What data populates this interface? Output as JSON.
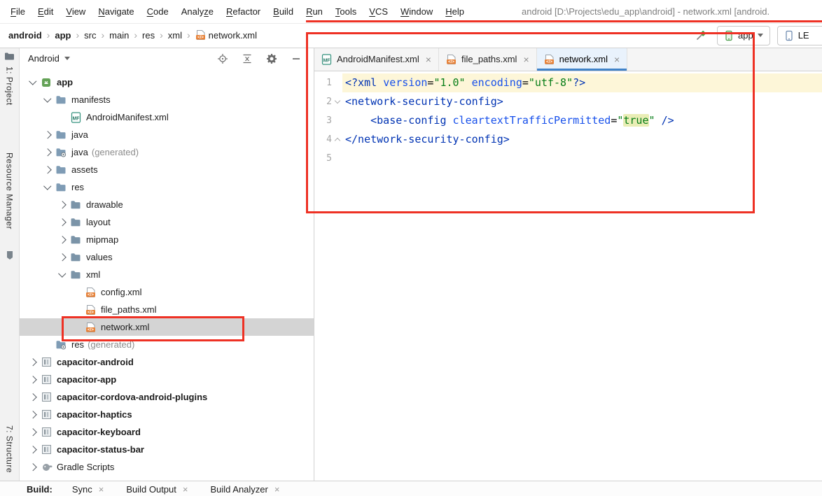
{
  "colors": {
    "annotation_red": "#ee3124",
    "tab_accent": "#4083c9",
    "tree_selection": "#d4d4d4",
    "caret_line": "#fdf6d8",
    "value_highlight": "#e9edb5"
  },
  "menu_bar": {
    "items": [
      {
        "label": "File",
        "mnemonic": 0
      },
      {
        "label": "Edit",
        "mnemonic": 0
      },
      {
        "label": "View",
        "mnemonic": 0
      },
      {
        "label": "Navigate",
        "mnemonic": 0
      },
      {
        "label": "Code",
        "mnemonic": 0
      },
      {
        "label": "Analyze",
        "mnemonic": 5
      },
      {
        "label": "Refactor",
        "mnemonic": 0
      },
      {
        "label": "Build",
        "mnemonic": 0
      },
      {
        "label": "Run",
        "mnemonic": 0
      },
      {
        "label": "Tools",
        "mnemonic": 0
      },
      {
        "label": "VCS",
        "mnemonic": 0
      },
      {
        "label": "Window",
        "mnemonic": 0
      },
      {
        "label": "Help",
        "mnemonic": 0
      }
    ],
    "window_title": "android [D:\\Projects\\edu_app\\android] - network.xml [android."
  },
  "toolbar": {
    "breadcrumbs": [
      {
        "label": "android",
        "bold": true
      },
      {
        "label": "app",
        "bold": true
      },
      {
        "label": "src"
      },
      {
        "label": "main"
      },
      {
        "label": "res"
      },
      {
        "label": "xml"
      },
      {
        "label": "network.xml",
        "icon": "xml-file"
      }
    ],
    "run_config_label": "app",
    "device_button_label": "LE"
  },
  "tool_stripe": {
    "items": [
      {
        "kind": "icon",
        "icon": "project-icon",
        "name": "project-stripe-icon"
      },
      {
        "kind": "label",
        "label": "1: Project",
        "name": "tool-window-button-project"
      },
      {
        "kind": "label",
        "label": "Resource Manager",
        "name": "tool-window-button-resource-manager"
      },
      {
        "kind": "icon",
        "icon": "pin-icon",
        "name": "stripe-pin-icon"
      },
      {
        "kind": "label",
        "label": "7: Structure",
        "name": "tool-window-button-structure"
      }
    ]
  },
  "project_panel": {
    "view_selector": "Android",
    "header_icons": [
      {
        "button": "select-opened-file-button",
        "icon": "locate-icon"
      },
      {
        "button": "collapse-all-button",
        "icon": "collapse-all-icon"
      },
      {
        "button": "settings-button",
        "icon": "gear-icon"
      },
      {
        "button": "hide-panel-button",
        "icon": "hide-icon"
      }
    ],
    "tree": [
      {
        "label": "app",
        "level": 0,
        "chevron": "expanded",
        "icon": "app-module",
        "bold": true
      },
      {
        "label": "manifests",
        "level": 1,
        "chevron": "expanded",
        "icon": "folder"
      },
      {
        "label": "AndroidManifest.xml",
        "level": 2,
        "chevron": "none",
        "icon": "manifest-file"
      },
      {
        "label": "java",
        "level": 1,
        "chevron": "collapsed",
        "icon": "folder"
      },
      {
        "label": "java",
        "suffix": "(generated)",
        "level": 1,
        "chevron": "collapsed",
        "icon": "folder-generated"
      },
      {
        "label": "assets",
        "level": 1,
        "chevron": "collapsed",
        "icon": "folder"
      },
      {
        "label": "res",
        "level": 1,
        "chevron": "expanded",
        "icon": "folder"
      },
      {
        "label": "drawable",
        "level": 2,
        "chevron": "collapsed",
        "icon": "res-folder"
      },
      {
        "label": "layout",
        "level": 2,
        "chevron": "collapsed",
        "icon": "res-folder"
      },
      {
        "label": "mipmap",
        "level": 2,
        "chevron": "collapsed",
        "icon": "res-folder"
      },
      {
        "label": "values",
        "level": 2,
        "chevron": "collapsed",
        "icon": "res-folder"
      },
      {
        "label": "xml",
        "level": 2,
        "chevron": "expanded",
        "icon": "res-folder"
      },
      {
        "label": "config.xml",
        "level": 3,
        "chevron": "none",
        "icon": "xml-file"
      },
      {
        "label": "file_paths.xml",
        "level": 3,
        "chevron": "none",
        "icon": "xml-file"
      },
      {
        "label": "network.xml",
        "level": 3,
        "chevron": "none",
        "icon": "xml-file",
        "selected": true
      },
      {
        "label": "res",
        "suffix": "(generated)",
        "level": 1,
        "chevron": "none",
        "icon": "folder-generated"
      },
      {
        "label": "capacitor-android",
        "level": 0,
        "chevron": "collapsed",
        "icon": "module",
        "bold": true
      },
      {
        "label": "capacitor-app",
        "level": 0,
        "chevron": "collapsed",
        "icon": "module",
        "bold": true
      },
      {
        "label": "capacitor-cordova-android-plugins",
        "level": 0,
        "chevron": "collapsed",
        "icon": "module",
        "bold": true
      },
      {
        "label": "capacitor-haptics",
        "level": 0,
        "chevron": "collapsed",
        "icon": "module",
        "bold": true
      },
      {
        "label": "capacitor-keyboard",
        "level": 0,
        "chevron": "collapsed",
        "icon": "module",
        "bold": true
      },
      {
        "label": "capacitor-status-bar",
        "level": 0,
        "chevron": "collapsed",
        "icon": "module",
        "bold": true
      },
      {
        "label": "Gradle Scripts",
        "level": 0,
        "chevron": "collapsed",
        "icon": "gradle"
      }
    ]
  },
  "editor": {
    "tabs": [
      {
        "label": "AndroidManifest.xml",
        "icon": "manifest-file",
        "active": false
      },
      {
        "label": "file_paths.xml",
        "icon": "xml-file",
        "active": false
      },
      {
        "label": "network.xml",
        "icon": "xml-file",
        "active": true
      }
    ],
    "lines": [
      {
        "num": "1",
        "caret_line": true,
        "spans": [
          {
            "t": "<?xml ",
            "c": "tag"
          },
          {
            "t": "version",
            "c": "attr"
          },
          {
            "t": "=",
            "c": "plain"
          },
          {
            "t": "\"1.0\"",
            "c": "str"
          },
          {
            "t": " ",
            "c": "plain"
          },
          {
            "t": "encoding",
            "c": "attr"
          },
          {
            "t": "=",
            "c": "plain"
          },
          {
            "t": "\"utf-8\"",
            "c": "str"
          },
          {
            "t": "?>",
            "c": "tag"
          }
        ]
      },
      {
        "num": "2",
        "fold": "start",
        "spans": [
          {
            "t": "<network-security-config>",
            "c": "tag"
          }
        ]
      },
      {
        "num": "3",
        "spans": [
          {
            "t": "    ",
            "c": "plain"
          },
          {
            "t": "<base-config ",
            "c": "tag"
          },
          {
            "t": "cleartextTrafficPermitted",
            "c": "attr"
          },
          {
            "t": "=",
            "c": "plain"
          },
          {
            "t": "\"",
            "c": "str"
          },
          {
            "t": "true",
            "c": "str hl"
          },
          {
            "t": "\"",
            "c": "str"
          },
          {
            "t": " ",
            "c": "plain"
          },
          {
            "t": "/>",
            "c": "tag"
          }
        ]
      },
      {
        "num": "4",
        "fold": "end",
        "spans": [
          {
            "t": "</network-security-config>",
            "c": "tag"
          }
        ]
      },
      {
        "num": "5",
        "spans": []
      }
    ]
  },
  "bottom_bar": {
    "label": "Build:",
    "tabs": [
      {
        "label": "Sync"
      },
      {
        "label": "Build Output"
      },
      {
        "label": "Build Analyzer"
      }
    ]
  }
}
